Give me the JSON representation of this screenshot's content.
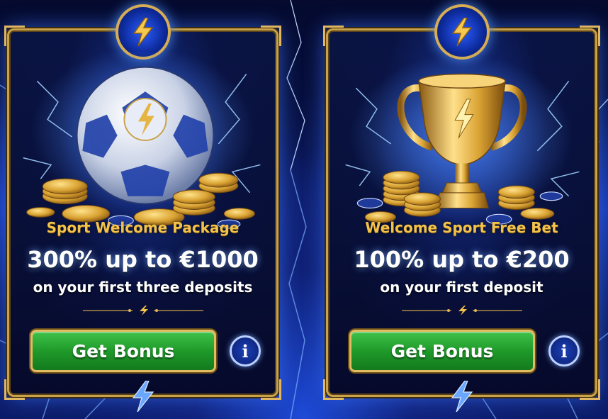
{
  "cards": [
    {
      "title": "Sport Welcome Package",
      "amount": "300% up to €1000",
      "subtitle": "on your first three deposits",
      "button_label": "Get Bonus",
      "info_label": "i",
      "art_icon": "soccer-ball-with-gold-coins"
    },
    {
      "title": "Welcome Sport Free Bet",
      "amount": "100% up to €200",
      "subtitle": "on your first deposit",
      "button_label": "Get Bonus",
      "info_label": "i",
      "art_icon": "gold-trophy-with-coins"
    }
  ],
  "colors": {
    "accent_gold": "#f2c24a",
    "button_green": "#1f9a2a",
    "electric_blue": "#2a5cff"
  }
}
